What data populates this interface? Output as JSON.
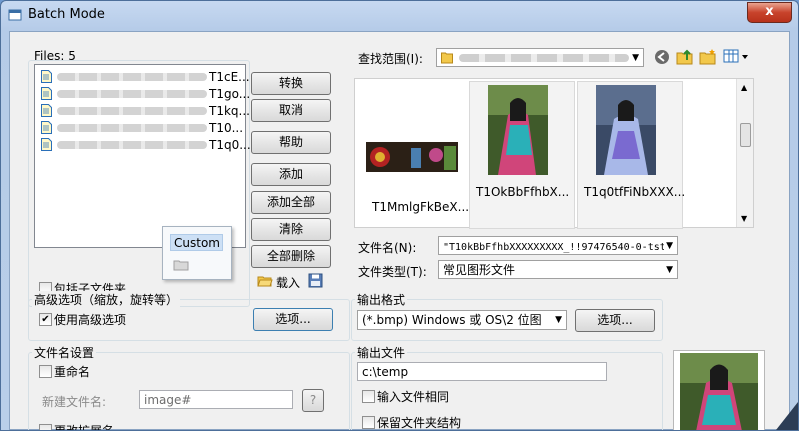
{
  "window": {
    "title": "Batch Mode",
    "close_glyph": "x"
  },
  "file_list": {
    "count_label": "Files: 5",
    "files": [
      "T1cE...",
      "T1go...",
      "T1kq...",
      "T10...",
      "T1q0..."
    ]
  },
  "buttons": {
    "convert": "转换",
    "cancel": "取消",
    "help": "帮助",
    "add": "添加",
    "add_all": "添加全部",
    "clear": "清除",
    "remove_all": "全部删除",
    "load": "载入"
  },
  "custom_popup": {
    "label": "Custom"
  },
  "include_subfolders": {
    "label": "包括子文件夹",
    "checked": false
  },
  "advanced": {
    "group_label": "高级选项（缩放，旋转等）",
    "use_advanced_label": "使用高级选项",
    "use_advanced_checked": true,
    "options_button": "选项..."
  },
  "filename_settings": {
    "group_label": "文件名设置",
    "rename_label": "重命名",
    "new_name_label": "新建文件名:",
    "new_name_value": "image#",
    "help_button": "?",
    "change_ext_label": "更改扩展名"
  },
  "browser": {
    "look_in_label": "查找范围(I):",
    "thumbnails": [
      {
        "caption": "T1MmlgFkBeX..."
      },
      {
        "caption": "T1OkBbFfhbX..."
      },
      {
        "caption": "T1q0tfFiNbXXX..."
      }
    ],
    "filename_label": "文件名(N):",
    "filename_value": "\"T10kBbFfhbXXXXXXXXX_!!97476540-0-tst",
    "filetype_label": "文件类型(T):",
    "filetype_value": "常见图形文件"
  },
  "output_format": {
    "group_label": "输出格式",
    "format_value": "(*.bmp) Windows 或 OS\\2 位图",
    "options_button": "选项..."
  },
  "output_file": {
    "group_label": "输出文件",
    "path_value": "c:\\temp",
    "same_as_input_label": "输入文件相同",
    "keep_structure_label": "保留文件夹结构"
  },
  "colors": {
    "accent": "#3399ff",
    "title_gradient_top": "#c7d9f1",
    "close_red": "#c8432c"
  }
}
